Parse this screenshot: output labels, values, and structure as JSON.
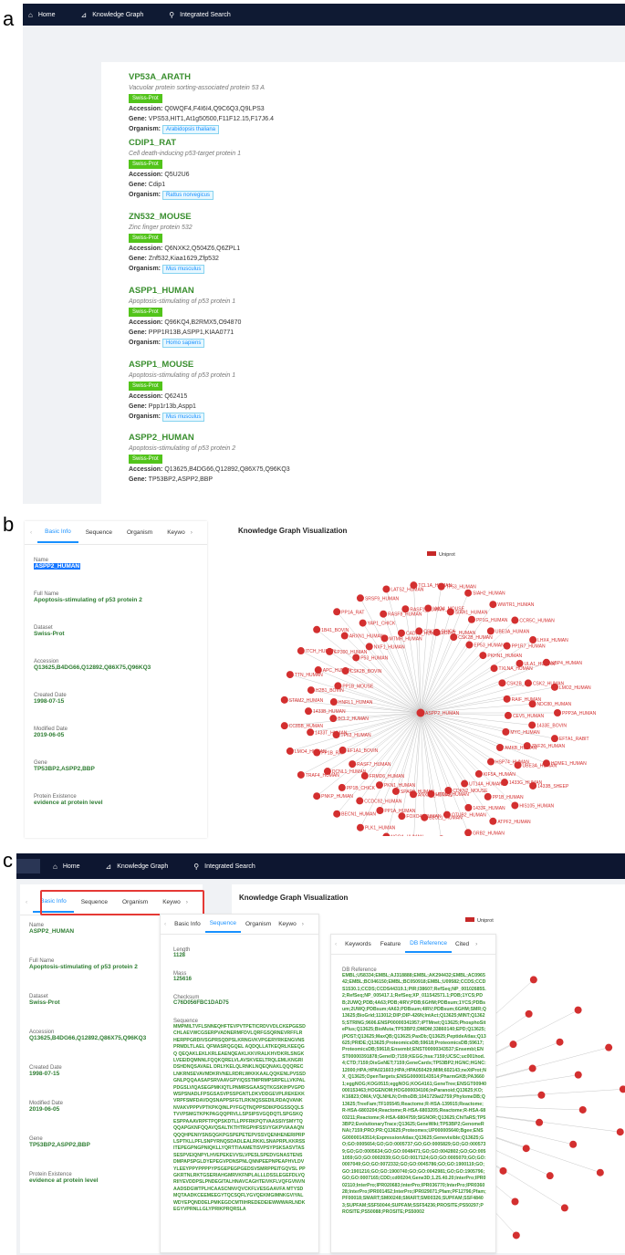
{
  "panels": {
    "a": "a",
    "b": "b",
    "c": "c"
  },
  "nav": {
    "home": "Home",
    "kg": "Knowledge Graph",
    "search": "Integrated Search"
  },
  "entries": [
    {
      "title": "VP53A_ARATH",
      "desc": "Vacuolar protein sorting-associated protein 53 A",
      "tag": "Swiss-Prot",
      "accession": "Q0WQF4,F4I6I4,Q9C6Q3,Q9LPS3",
      "gene": "VPS53,HIT1,At1g50500,F11F12.15,F17J6.4",
      "organism": "Arabidopsis thaliana"
    },
    {
      "title": "CDIP1_RAT",
      "desc": "Cell death-inducing p53-target protein 1",
      "tag": "Swiss-Prot",
      "accession": "Q5U2U6",
      "gene": "Cdip1",
      "organism": "Rattus norvegicus"
    },
    {
      "title": "ZN532_MOUSE",
      "desc": "Zinc finger protein 532",
      "tag": "Swiss-Prot",
      "accession": "Q6NXK2,Q504Z6,Q6ZPL1",
      "gene": "Znf532,Kiaa1629,Zfp532",
      "organism": "Mus musculus"
    },
    {
      "title": "ASPP1_HUMAN",
      "desc": "Apoptosis-stimulating of p53 protein 1",
      "tag": "Swiss-Prot",
      "accession": "Q96KQ4,B2RMX5,O94870",
      "gene": "PPP1R13B,ASPP1,KIAA0771",
      "organism": "Homo sapiens"
    },
    {
      "title": "ASPP1_MOUSE",
      "desc": "Apoptosis-stimulating of p53 protein 1",
      "tag": "Swiss-Prot",
      "accession": "Q62415",
      "gene": "Ppp1r13b,Aspp1",
      "organism": "Mus musculus"
    },
    {
      "title": "ASPP2_HUMAN",
      "desc": "Apoptosis-stimulating of p53 protein 2",
      "tag": "Swiss-Prot",
      "accession": "Q13625,B4DG66,Q12892,Q86X75,Q96KQ3",
      "gene": "TP53BP2,ASPP2,BBP"
    }
  ],
  "labels": {
    "accession": "Accession:",
    "gene": "Gene:",
    "organism": "Organism:"
  },
  "tabs": {
    "basic": "Basic Info",
    "sequence": "Sequence",
    "organism": "Organism",
    "keyword": "Keywo",
    "keywords": "Keywords",
    "feature": "Feature",
    "dbref": "DB Reference",
    "cited": "Cited"
  },
  "info": [
    {
      "label": "Name",
      "value": "ASPP2_HUMAN"
    },
    {
      "label": "Full Name",
      "value": "Apoptosis-stimulating of p53 protein 2"
    },
    {
      "label": "Dataset",
      "value": "Swiss-Prot"
    },
    {
      "label": "Accession",
      "value": "Q13625,B4DG66,Q12892,Q86X75,Q96KQ3"
    },
    {
      "label": "Created Date",
      "value": "1998-07-15"
    },
    {
      "label": "Modified Date",
      "value": "2019-06-05"
    },
    {
      "label": "Gene",
      "value": "TP53BP2,ASPP2,BBP"
    },
    {
      "label": "Protein Existence",
      "value": "evidence at protein level"
    }
  ],
  "kg": {
    "title": "Knowledge Graph Visualization",
    "legend": "Uniprot",
    "center": "ASPP2_HUMAN"
  },
  "kg_nodes": [
    "PPP3A_HUMAN",
    "1433E_BOVIN",
    "MYC_HUMAN",
    "EFTA1_RABIT",
    "ZNF26_HUMAN",
    "AMKB_HUMAN",
    "HOME1_HUMAN",
    "UBE3A_HUMAN",
    "HSP74_HUMAN",
    "1433B_SHEEP",
    "1433G_HUMAN",
    "KIF5A_HUMAN",
    "HIS105_HUMAN",
    "PP1B_HUMAN",
    "UT14A_HUMAN",
    "ATPF2_HUMAN",
    "1433F_HUMAN",
    "CDKN2_MOUSE",
    "GRB2_HUMAN",
    "OTUB2_HUMAN",
    "UTT16_HUMAN",
    "ATAT_HUMAN",
    "B2CL1_HUMAN",
    "ANXA1_HUMAN",
    "CSK20_HUMAN",
    "FOXO4_HUMAN",
    "SPAR2_HUMAN",
    "NCOA_HUMAN",
    "PP1A_HUMAN",
    "PKN1_HUMAN",
    "PLK1_HUMAN",
    "CCDC92_HUMAN",
    "FRMD6_HUMAN",
    "BECN1_HUMAN",
    "PP1B_CHICK",
    "RASF7_HUMAN",
    "PNKP_HUMAN",
    "DCNL1_HUMAN",
    "EF1A1_BOVIN",
    "TRAF4_HUMAN",
    "PP1B_RAT",
    "TP63_HUMAN",
    "LMO4_HUMAN",
    "1433T_HUMAN",
    "BCL2_HUMAN",
    "CC85B_HUMAN",
    "1433B_HUMAN",
    "HNRL1_HUMAN",
    "STAM2_HUMAN",
    "H2B1_BOVIN",
    "PP1B_MOUSE",
    "TTN_HUMAN",
    "APC_HUMAN",
    "CSK2B_BOVIN",
    "ITCH_HUMAN",
    "EP300_HUMAN",
    "P53_HUMAN",
    "1B41_BOVIN",
    "ARXN1_HUMAN",
    "NXF1_HUMAN",
    "PP1A_RAT",
    "YAP1_CHICK",
    "MTMR_HUMAN",
    "SRSF9_HUMAN",
    "RASF8_HUMAN",
    "CADH1_HUMAN",
    "LATS2_HUMAN",
    "RASF1_HUMAN",
    "CSK2B_CHICK",
    "TCL1A_HUMAN",
    "LMO4_MOUSE",
    "ZO2HT_HUMAN",
    "TP53_HUMAN",
    "SIAH1_HUMAN",
    "CSK2B_HUMAN",
    "SIAH2_HUMAN",
    "PP1G_HUMAN",
    "EP53_HUMAN",
    "WWTR1_HUMAN",
    "UBE3A_HUMAN",
    "PKHN1_HUMAN",
    "CCR5C_HUMAN",
    "PP1R7_HUMAN",
    "TXLNA_HUMAN",
    "LHX4_HUMAN",
    "ULA1_HUMAN",
    "CSK2B_PIG",
    "UBP4_HUMAN",
    "CSK2_HUMAN",
    "RAIF_HUMAN",
    "LMO2_HUMAN",
    "NDC80_HUMAN",
    "CEV5_HUMAN"
  ],
  "seq": {
    "length_label": "Length",
    "length": "1128",
    "mass_label": "Mass",
    "mass": "125616",
    "checksum_label": "Checksum",
    "checksum": "C76D056FBC1DAD75",
    "sequence_label": "Sequence",
    "text": "MMPMILTVFLSNNEQHFTEVPVTPETICRDVVDLCKEPGESDCHLAEVWCGSERPVADNERMFDVLQRFGSQRNEVRFFLRHERPPGRDIVSGPRSQDPSLKRNGVKVPGERYRKENGVNSPRMDLTLAEL QFMASRQGQEL AQDQLLATKEQRLKEEQGQ QEQAKLEKLKRLEAENQEAKLKKVRALKHVDKRLSNGKLVEEIDQMNNLFQQKQRELVLAVSKVEELTRQLEMLKNGRIDSHDNQSAVAEL DRLYKELQLRNKLNQEQNAKLQQQRECLNKRNSEVAVMDKRVNELRDRLWKKKAALQQKENLPVSSDGNLPQQAASAPSRVAAVGPYIQSSTMPRMPSRPELLVKPALPDGSLVIQASEGPMKIQTLPNMRSGAASQTKGSKIHPVGPDWSPSNADLFPSGSASVPSSPGNTLDKVDDGEVPLREKEKKVRPFSMFDAVDQSNAPPSFGTLRKNQSSEDILRDAQVANKNVAKVPPPVPTKPKQINLPYFGQTNQPPSDIKPDGSSQQLSTVVPSMGTKPKPAGQQPRVLLSPSIPSVGQDQTLSPGSKQESPPAAAVRPFTPQPSKDTLLPPFRKPQTVAASSIYSMYTQQQAPGKNFQQAVQSALTKTHTRGPHFSSVYGKPVIAAAQNQQQHPENIYSNSQGKPGSPEPETEPVSSVQENHENERIPRPLSPTKLLPFLSNPYRNQSDADLEALRKKLSNAPRPLKKRSSITEPEGPNGPNIQKLLYQRTTIAAMETISVPSYPSKSASVTASSESPVEIQNPYLHVEPEKEVVSLVPESLSPEDVGNASTENSDMPAPSPGLDYEPEGVPDNSPNLQNNPEEPNPEAPHVLDVYLEEYPPYPPPPYPSGEPEGPGEDSVSMRPPEITGQVSL PPGKRTNLRKTGSERIAHGMRVKFNPLALLLDSSLEGEFDLVQRIIYEVDDPSLPNDEGITALHNAVCAGHTEIVKFLVQFGVNVNAADSDGWTPLHCAASCNNVQVCKFLVESGAAVFA MTYSDMQTAADKCEEMEEGYTQCSQFLYGVQEKMGIMNKGVIYALWDYEPQNDDELPMKEGDCMTIIHREDEDEIEWWWARLNDKEGYVPRNLLGLYPRIKPRQRSLA"
  },
  "dbref": {
    "label": "DB Reference",
    "text": "EMBL;U58334;EMBL;AJ318888;EMBL;AK294432;EMBL;AC096542;EMBL;BC046150;EMBL;BC050918;EMBL;U09582;CCDS;CCDS1530.1;CCDS;CCDS44319.1;PIR;I38607;RefSeq;NP_001026855.2;RefSeq;NP_005417.1;RefSeq;XP_011542571.1;PDB;1YCS;PDB;2UWQ;PDB;4A63;PDB;4IRV;PDB;6GHM;PDBsum;1YCS;PDBsum;2UWQ;PDBsum;4A63;PDBsum;4IRV;PDBsum;6GHM;SMR;Q13625;BioGrid;113012;DIP;DIP-426N;IntAct;Q13625;MINT;Q13625;STRING;9606.ENSP00000341957;iPTMnet;Q13625;PhosphoSitePlus;Q13625;BioMuta;TP53BP2;DMDM;33860140;EPD;Q13625;jPOST;Q13625;MaxQB;Q13625;PaxDb;Q13625;PeptideAtlas;Q13625;PRIDE;Q13625;ProteomicsDB;59618;ProteomicsDB;59617;ProteomicsDB;59618;Ensembl;ENST00000343537;Ensembl;ENST00000391878;GeneID;7159;KEGG;hsa:7159;UCSC;uc001hod.4;CTD;7159;DisGeNET;7159;GeneCards;TP53BP2;HGNC;HGNC:12000;HPA;HPA021603;HPA;HPA050429;MIM;602143;neXtProt;NX_Q13625;OpenTargets;ENSG00000143514;PharmGKB;PA36601;eggNOG;KOG0515;eggNOG;KOG4161;GeneTree;ENSGT00940000153463;HOGENOM;HOG000034106;InParanoid;Q13625;KO;K16823;OMA;VQLNHLN;OrthoDB;1041729at2759;PhylomeDB;Q13625;TreeFam;TF105545;Reactome;R-HSA-139915;Reactome;R-HSA-6803204;Reactome;R-HSA-6803205;Reactome;R-HSA-6803211;Reactome;R-HSA-6804759;SIGNOR;Q13625;ChiTaRS;TP53BP2;EvolutionaryTrace;Q13625;GeneWiki;TP53BP2;GenomeRNAi;7159;PRO;PR:Q13625;Proteomes;UP000005640;Bgee;ENSG00000143514;ExpressionAtlas;Q13625;Genevisible;Q13625;GO;GO:0005654;GO;GO:0005737;GO;GO:0005829;GO;GO:0005739;GO;GO:0005634;GO;GO:0048471;GO;GO:0042802;GO;GO:0051059;GO;GO:0002039;GO;GO:0017124;GO;GO:0005070;GO;GO:0007049;GO;GO:0072332;GO;GO:0045786;GO;GO:1900119;GO;GO:1901216;GO;GO:1900740;GO;GO:0042981;GO;GO:1905796;GO;GO:0007165;CDD;cd00204;Gene3D;1.25.40.20;InterPro;IPR002110;InterPro;IPR020683;InterPro;IPR036770;InterPro;IPR036028;InterPro;IPR001452;InterPro;IPR029071;Pfam;PF12796;Pfam;PF00018;SMART;SM00248;SMART;SM00326;SUPFAM;SSF48403;SUPFAM;SSF50044;SUPFAM;SSF54236;PROSITE;PS50297;PROSITE;PS50088;PROSITE;PS50002"
  }
}
